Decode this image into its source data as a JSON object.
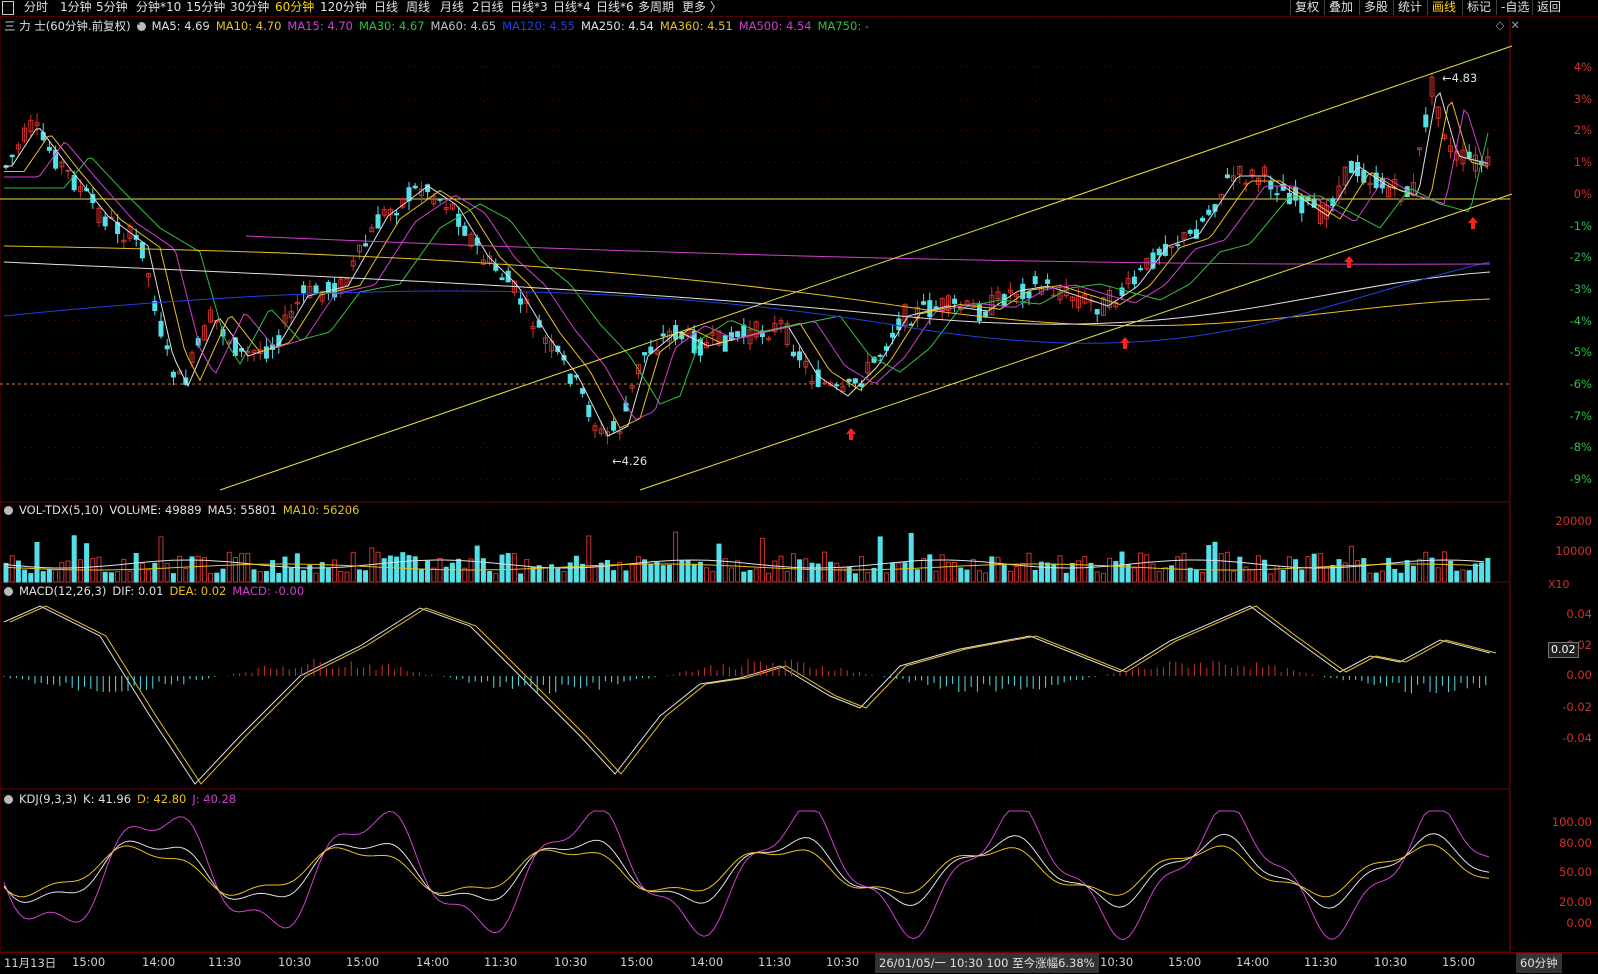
{
  "toolbar": {
    "tabs": [
      "分时",
      "1分钟",
      "5分钟",
      "分钟*10",
      "15分钟",
      "30分钟",
      "60分钟",
      "120分钟",
      "日线",
      "周线",
      "月线",
      "2日线",
      "日线*3",
      "日线*4",
      "日线*6",
      "多周期",
      "更多 〉"
    ],
    "active_tab": "60分钟",
    "right_buttons": [
      "复权",
      "叠加",
      "多股",
      "统计",
      "画线",
      "标记",
      "-自选",
      "返回"
    ],
    "active_right": "画线"
  },
  "main_legend": {
    "name": "三 力 士(60分钟.前复权)",
    "items": [
      {
        "label": "MA5: 4.69",
        "color": "#e0e0e0"
      },
      {
        "label": "MA10: 4.70",
        "color": "#e8c020"
      },
      {
        "label": "MA15: 4.70",
        "color": "#d040d0"
      },
      {
        "label": "MA30: 4.67",
        "color": "#30c040"
      },
      {
        "label": "MA60: 4.65",
        "color": "#c0c0c0"
      },
      {
        "label": "MA120: 4.55",
        "color": "#2040e0"
      },
      {
        "label": "MA250: 4.54",
        "color": "#e0e0e0"
      },
      {
        "label": "MA360: 4.51",
        "color": "#e8c020"
      },
      {
        "label": "MA500: 4.54",
        "color": "#d040d0"
      },
      {
        "label": "MA750: -",
        "color": "#30c040"
      }
    ]
  },
  "price_axis": [
    "4%",
    "3%",
    "2%",
    "1%",
    "0%",
    "-1%",
    "-2%",
    "-3%",
    "-4%",
    "-5%",
    "-6%",
    "-7%",
    "-8%",
    "-9%"
  ],
  "annotations": {
    "high": "4.83",
    "low": "4.26"
  },
  "vol_legend": {
    "name": "VOL-TDX(5,10)",
    "items": [
      {
        "label": "VOLUME: 49889",
        "color": "#e0e0e0"
      },
      {
        "label": "MA5: 55801",
        "color": "#e0e0e0"
      },
      {
        "label": "MA10: 56206",
        "color": "#e8c020"
      }
    ]
  },
  "vol_axis": [
    "20000",
    "10000"
  ],
  "vol_unit": "X10",
  "macd_legend": {
    "name": "MACD(12,26,3)",
    "items": [
      {
        "label": "DIF: 0.01",
        "color": "#e0e0e0"
      },
      {
        "label": "DEA: 0.02",
        "color": "#e8c020"
      },
      {
        "label": "MACD: -0.00",
        "color": "#d040d0"
      }
    ]
  },
  "macd_axis": [
    "0.04",
    "0.02",
    "0.00",
    "-0.02",
    "-0.04"
  ],
  "macd_tag": "0.02",
  "kdj_legend": {
    "name": "KDJ(9,3,3)",
    "items": [
      {
        "label": "K: 41.96",
        "color": "#e0e0e0"
      },
      {
        "label": "D: 42.80",
        "color": "#e8c020"
      },
      {
        "label": "J: 40.28",
        "color": "#d040d0"
      }
    ]
  },
  "kdj_axis": [
    "100.00",
    "80.00",
    "50.00",
    "20.00",
    "0.00"
  ],
  "x_axis": {
    "labels": [
      "11月13日",
      "15:00",
      "14:00",
      "11:30",
      "10:30",
      "15:00",
      "14:00",
      "11:30",
      "10:30",
      "15:00",
      "14:00",
      "11:30",
      "10:30",
      "26/01/05/一 10:30 100 至今涨幅6.38%",
      "10:30",
      "15:00",
      "14:00",
      "11:30",
      "10:30",
      "15:00"
    ],
    "period": "60分钟"
  },
  "colors": {
    "up": "#d0312d",
    "down": "#54e0e8",
    "trend": "#e8e040",
    "grid": "#5a0000"
  }
}
